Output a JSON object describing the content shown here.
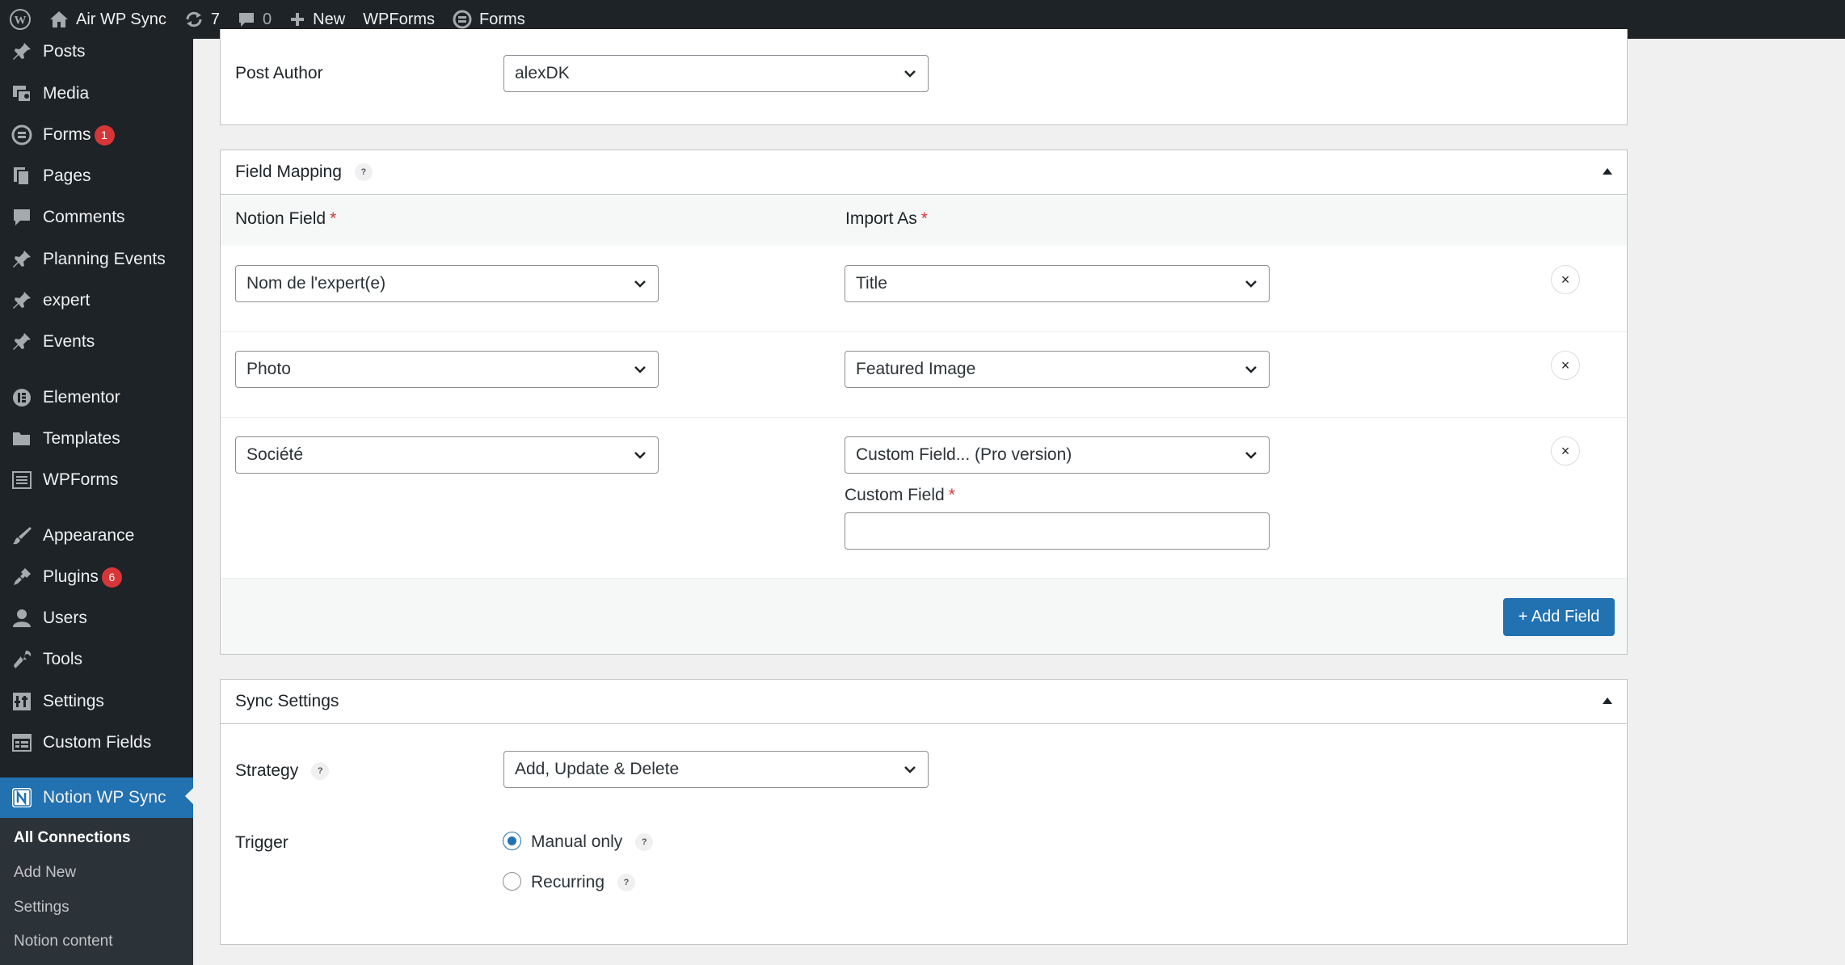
{
  "adminbar": {
    "site_name": "Air WP Sync",
    "updates_count": "7",
    "comments_count": "0",
    "new_label": "New",
    "wpforms_label": "WPForms",
    "forms_label": "Forms"
  },
  "sidebar": {
    "items": [
      {
        "label": "Posts",
        "icon": "pin-icon"
      },
      {
        "label": "Media",
        "icon": "media-icon"
      },
      {
        "label": "Forms",
        "icon": "forms-icon",
        "badge": "1"
      },
      {
        "label": "Pages",
        "icon": "pages-icon"
      },
      {
        "label": "Comments",
        "icon": "comment-icon"
      },
      {
        "label": "Planning Events",
        "icon": "pin-icon"
      },
      {
        "label": "expert",
        "icon": "pin-icon"
      },
      {
        "label": "Events",
        "icon": "pin-icon"
      },
      {
        "label": "Elementor",
        "icon": "elementor-icon"
      },
      {
        "label": "Templates",
        "icon": "folder-icon"
      },
      {
        "label": "WPForms",
        "icon": "wpforms-icon"
      },
      {
        "label": "Appearance",
        "icon": "brush-icon"
      },
      {
        "label": "Plugins",
        "icon": "plug-icon",
        "badge": "6"
      },
      {
        "label": "Users",
        "icon": "user-icon"
      },
      {
        "label": "Tools",
        "icon": "wrench-icon"
      },
      {
        "label": "Settings",
        "icon": "settings-icon"
      },
      {
        "label": "Custom Fields",
        "icon": "grid-icon"
      },
      {
        "label": "Notion WP Sync",
        "icon": "notion-icon"
      }
    ],
    "submenu": [
      "All Connections",
      "Add New",
      "Settings",
      "Notion content"
    ]
  },
  "post_author": {
    "label": "Post Author",
    "value": "alexDK"
  },
  "field_mapping": {
    "title": "Field Mapping",
    "help": "?",
    "col_notion": "Notion Field",
    "col_import": "Import As",
    "required_mark": "*",
    "rows": [
      {
        "notion": "Nom de l'expert(e)",
        "import": "Title"
      },
      {
        "notion": "Photo",
        "import": "Featured Image"
      },
      {
        "notion": "Société",
        "import": "Custom Field... (Pro version)"
      }
    ],
    "custom_field_label": "Custom Field",
    "custom_field_value": "",
    "remove_symbol": "×",
    "add_button": "+ Add Field"
  },
  "sync_settings": {
    "title": "Sync Settings",
    "strategy_label": "Strategy",
    "strategy_value": "Add, Update & Delete",
    "trigger_label": "Trigger",
    "trigger_options": [
      "Manual only",
      "Recurring"
    ],
    "trigger_selected": "Manual only",
    "help": "?"
  },
  "colors": {
    "admin_dark": "#1d2327",
    "accent": "#2271b1",
    "badge": "#d63638"
  }
}
